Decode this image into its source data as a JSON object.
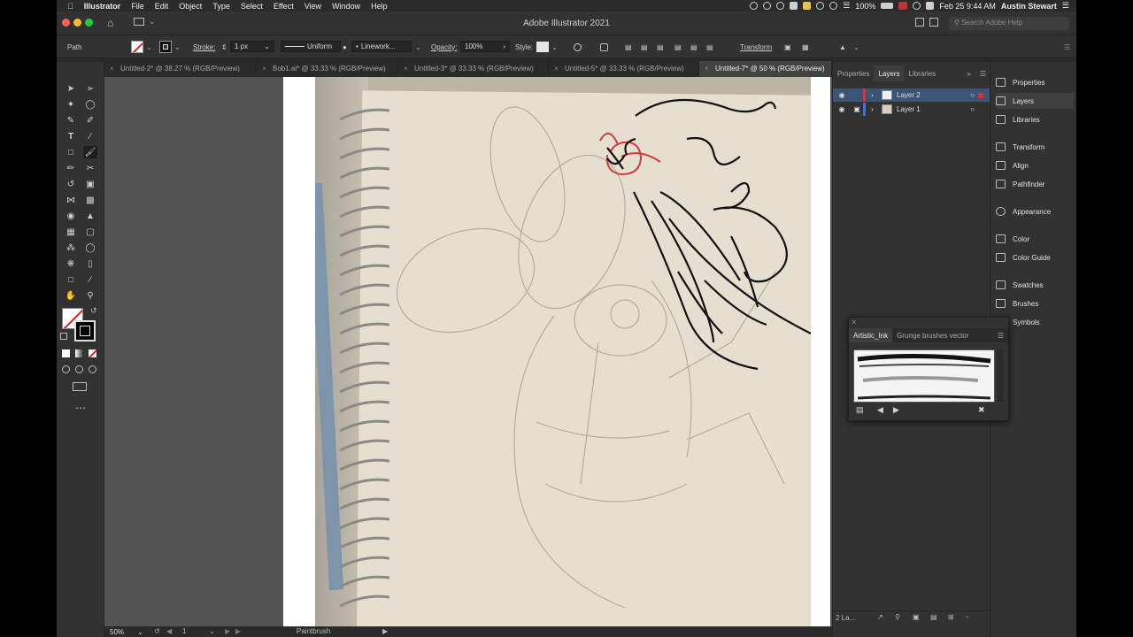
{
  "menubar": {
    "app": "Illustrator",
    "items": [
      "File",
      "Edit",
      "Object",
      "Type",
      "Select",
      "Effect",
      "View",
      "Window",
      "Help"
    ],
    "battery": "100%",
    "datetime": "Feb 25  9:44 AM",
    "user": "Austin Stewart"
  },
  "titlebar": {
    "title": "Adobe Illustrator 2021",
    "search_placeholder": "Search Adobe Help"
  },
  "controlbar": {
    "selection": "Path",
    "stroke_label": "Stroke:",
    "stroke_value": "1 px",
    "profile": "Uniform",
    "brush": "Linework...",
    "opacity_label": "Opacity:",
    "opacity_value": "100%",
    "style_label": "Style:",
    "transform_label": "Transform"
  },
  "tabs": [
    {
      "label": "Untitled-2* @ 38.27 % (RGB/Preview)",
      "active": false
    },
    {
      "label": "Bob1.ai* @ 33.33 % (RGB/Preview)",
      "active": false
    },
    {
      "label": "Untitled-3* @ 33.33 % (RGB/Preview)",
      "active": false
    },
    {
      "label": "Untitled-5* @ 33.33 % (RGB/Preview)",
      "active": false
    },
    {
      "label": "Untitled-7* @ 50 % (RGB/Preview)",
      "active": true
    }
  ],
  "statusbar": {
    "zoom": "50%",
    "artboard": "1",
    "tool": "Paintbrush"
  },
  "layers_panel": {
    "tabs": [
      "Properties",
      "Layers",
      "Libraries"
    ],
    "active_tab": "Layers",
    "layers": [
      {
        "name": "Layer 2",
        "color": "#e0302f",
        "selected": true
      },
      {
        "name": "Layer 1",
        "color": "#3d6fe0",
        "selected": false
      }
    ],
    "footer_count": "2 La..."
  },
  "right_dock": {
    "items": [
      "Properties",
      "Layers",
      "Libraries",
      "Transform",
      "Align",
      "Pathfinder",
      "Appearance",
      "Color",
      "Color Guide",
      "Swatches",
      "Brushes",
      "Symbols"
    ],
    "active": "Layers"
  },
  "brushes_panel": {
    "tabs": [
      "Artistic_Ink",
      "Grunge brushes vector"
    ],
    "active_tab": "Artistic_Ink"
  },
  "colors": {
    "accent_selection": "#e0302f",
    "ui_dark": "#323232"
  }
}
